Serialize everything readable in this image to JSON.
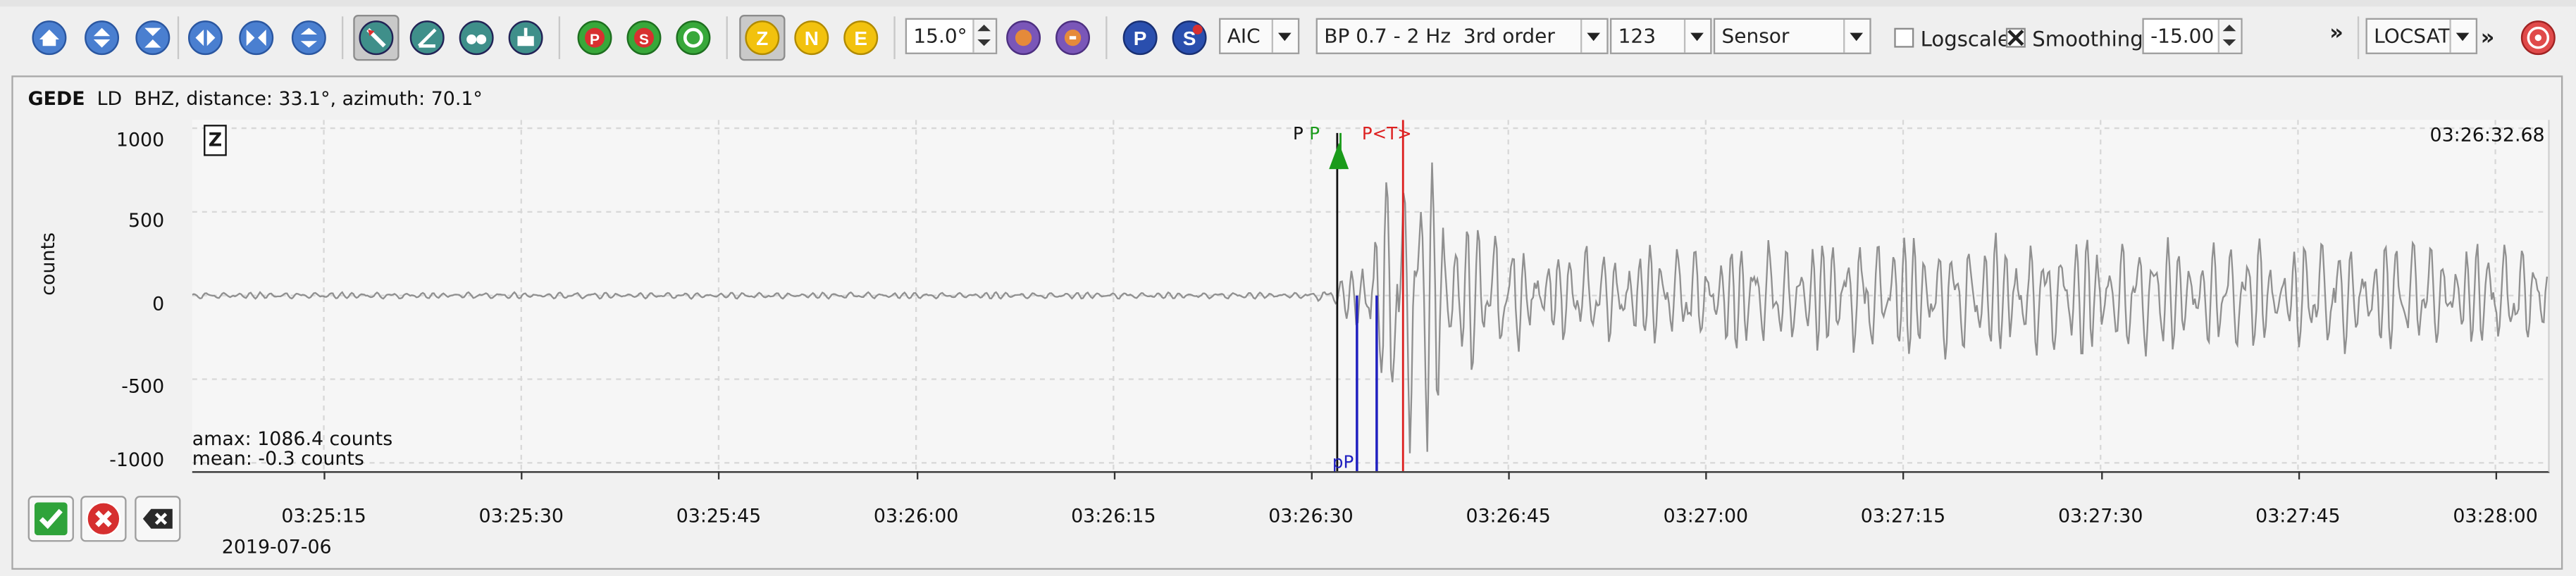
{
  "toolbar": {
    "azimuth_field": "15.0°",
    "picker_method": "AIC",
    "filter": "BP 0.7 - 2 Hz  3rd order",
    "rotation": "123",
    "unit_mode": "Sensor",
    "logscale_label": "Logscale",
    "logscale_checked": false,
    "smoothing_label": "Smoothing",
    "smoothing_checked": true,
    "offset_field": "-15.00",
    "overflow_chevron": "»",
    "locator": "LOCSAT",
    "end_chevron": "»",
    "component_buttons": [
      "Z",
      "N",
      "E"
    ],
    "phase_buttons": [
      "P",
      "S"
    ],
    "icons": [
      "home-icon",
      "zoom-in-vertical-icon",
      "zoom-out-vertical-icon",
      "zoom-in-horizontal-icon",
      "zoom-out-horizontal-icon",
      "zoom-reset-icon",
      "pick-tool-icon",
      "angle-icon",
      "binoculars-icon",
      "cursor-icon",
      "p-phase-icon",
      "s-phase-icon",
      "theoretical-icon",
      "compass-left-icon",
      "compass-right-icon",
      "accept-icon",
      "reject-icon",
      "clear-icon",
      "locate-icon"
    ]
  },
  "trace": {
    "station": "GEDE",
    "network_channel": "LD  BHZ,",
    "distance": "distance: 33.1°,",
    "azimuth": "azimuth: 70.1°",
    "component_badge": "Z",
    "cursor_time": "03:26:32.68",
    "ylabel": "counts",
    "amax": "amax: 1086.4 counts",
    "mean": "mean: -0.3 counts",
    "date": "2019-07-06"
  },
  "picks": [
    {
      "label": "P",
      "color": "#111111"
    },
    {
      "label": "P",
      "color": "#1a9b1a"
    },
    {
      "label": "P<T>",
      "color": "#dd2020"
    },
    {
      "label": "pP",
      "color": "#2020c0"
    }
  ],
  "chart_data": {
    "type": "line",
    "title": "",
    "xlabel": "",
    "ylabel": "counts",
    "ylim": [
      -1050,
      1050
    ],
    "yticks": [
      "1000",
      "500",
      "0",
      "-500",
      "-1000"
    ],
    "xticks": [
      "03:25:15",
      "03:25:30",
      "03:25:45",
      "03:26:00",
      "03:26:15",
      "03:26:30",
      "03:26:45",
      "03:27:00",
      "03:27:15",
      "03:27:30",
      "03:27:45",
      "03:28:00"
    ],
    "series": [
      {
        "color": "#909090",
        "x_seconds_from_032510": [
          0,
          80,
          81,
          82,
          83,
          84,
          85,
          86,
          87,
          88,
          89,
          90,
          91,
          92,
          93,
          94,
          95,
          96,
          97,
          98,
          99,
          100,
          105,
          110,
          115,
          120,
          130,
          140,
          150,
          160,
          170
        ],
        "y_envelope": [
          20,
          20,
          40,
          60,
          220,
          420,
          560,
          800,
          880,
          1086,
          950,
          820,
          700,
          560,
          460,
          420,
          380,
          340,
          320,
          320,
          300,
          300,
          300,
          320,
          350,
          360,
          380,
          380,
          370,
          360,
          340
        ]
      }
    ]
  },
  "actions": {
    "accept": "accept-icon",
    "reject": "reject-icon",
    "clear": "clear-icon"
  }
}
